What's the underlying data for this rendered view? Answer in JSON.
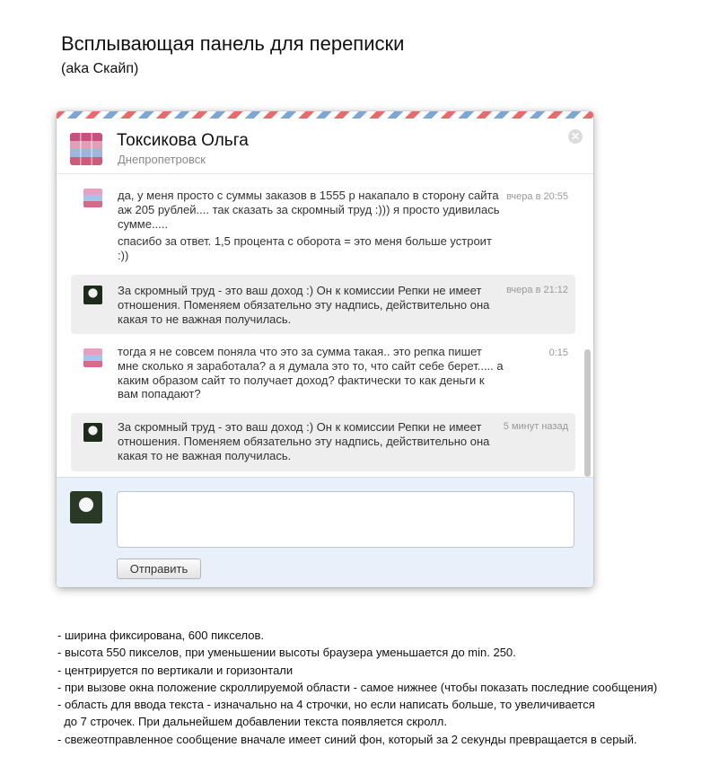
{
  "page": {
    "title": "Всплывающая панель для переписки",
    "subtitle": "(aka Скайп)"
  },
  "chat": {
    "contact_name": "Токсикова Ольга",
    "contact_city": "Днепропетровск",
    "close_icon": "close-icon",
    "messages": [
      {
        "author": "contact",
        "avatar_icon": "flowers-avatar",
        "paragraphs": [
          "да, у меня просто с суммы заказов в 1555 р накапало в сторону сайта аж 205 рублей.... так сказать за скромный труд :))) я просто удивилась сумме.....",
          "спасибо за ответ. 1,5 процента с оборота = это меня больше устроит :))"
        ],
        "time": "вчера в 20:55",
        "highlight": false
      },
      {
        "author": "me",
        "avatar_icon": "panda-avatar",
        "paragraphs": [
          "За скромный труд - это ваш доход :) Он к комиссии Репки не имеет отношения. Поменяем обязательно эту надпись, действительно она какая то не важная получилась."
        ],
        "time": "вчера в 21:12",
        "highlight": true
      },
      {
        "author": "contact",
        "avatar_icon": "flowers-avatar",
        "paragraphs": [
          "тогда я не совсем поняла что это за сумма такая.. это репка пишет мне сколько я заработала? а я думала это то, что сайт себе берет..... а каким образом сайт то получает доход? фактически то как деньги к вам попадают?"
        ],
        "time": "0:15",
        "highlight": false
      },
      {
        "author": "me",
        "avatar_icon": "panda-avatar",
        "paragraphs": [
          "За скромный труд - это ваш доход :) Он к комиссии Репки не имеет отношения. Поменяем обязательно эту надпись, действительно она какая то не важная получилась."
        ],
        "time": "5 минут назад",
        "highlight": true
      }
    ],
    "input": {
      "value": "",
      "placeholder": ""
    },
    "send_label": "Отправить"
  },
  "notes": [
    "- ширина фиксирована, 600 пикселов.",
    "- высота 550 пикселов, при уменьшении высоты браузера уменьшается до min. 250.",
    "- центрируется по вертикали и горизонтали",
    "- при вызове окна положение скроллируемой области - самое нижнее (чтобы показать последние сообщения)",
    "- область для ввода текста - изначально на 4 строчки, но если написать больше, то увеличивается",
    "  до 7 строчек. При дальнейшем добавлении текста появляется скролл.",
    "- свежеотправленное сообщение вначале имеет синий фон, который за 2 секунды превращается в серый."
  ],
  "colors": {
    "message_highlight_bg": "#eeeeee",
    "composer_bg": "#e8f0fa",
    "airmail_red": "#e86a6a",
    "airmail_blue": "#7ba6d6"
  }
}
